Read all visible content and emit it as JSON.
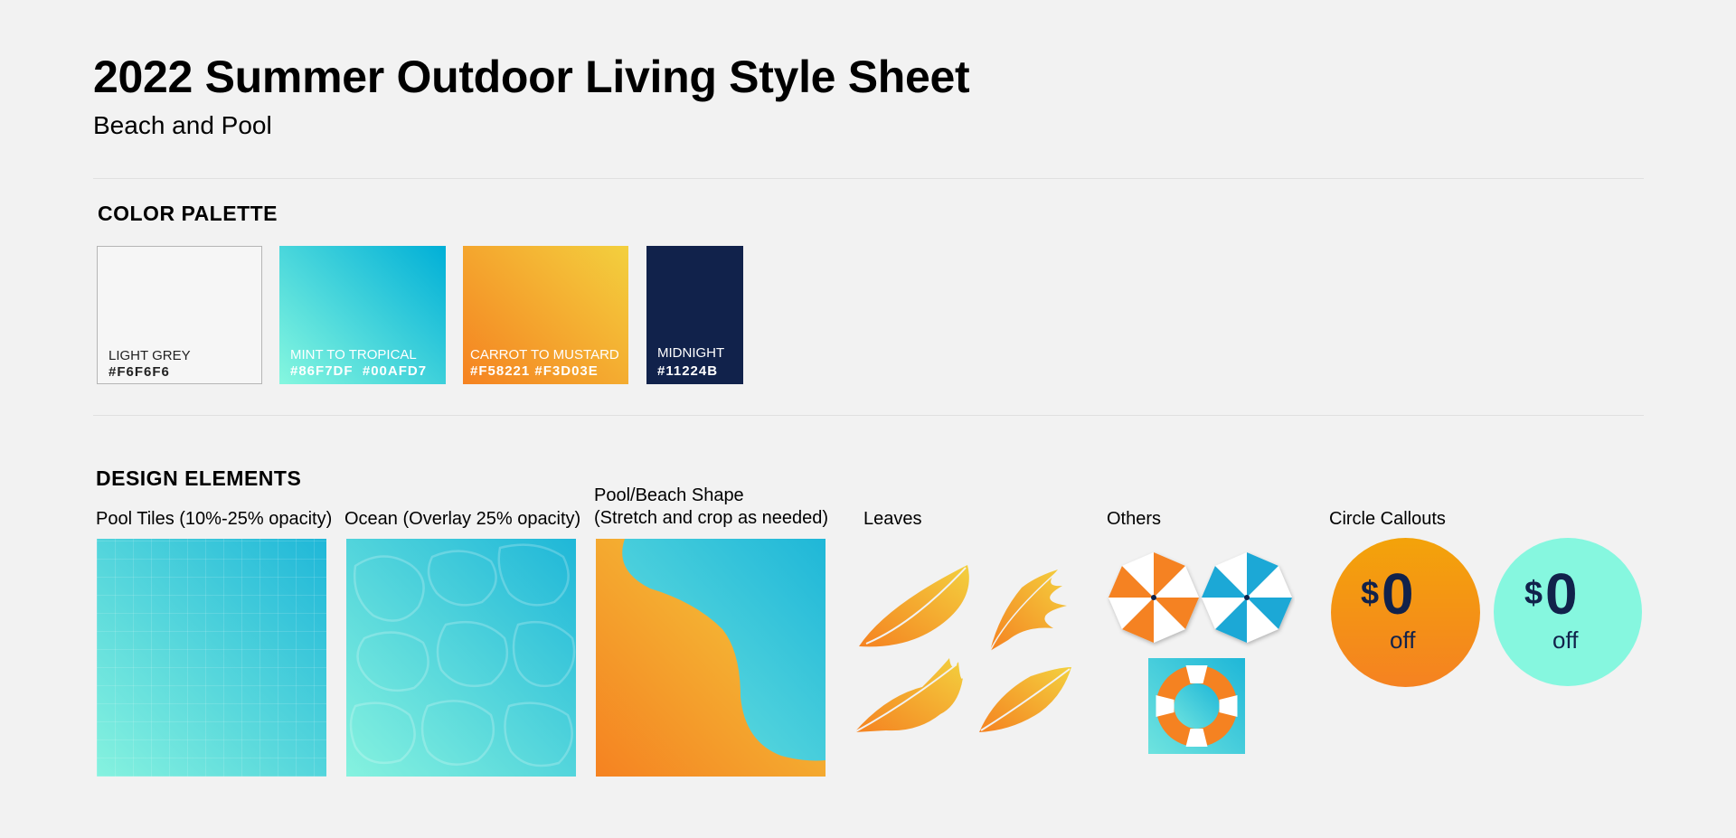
{
  "header": {
    "title": "2022 Summer Outdoor Living Style Sheet",
    "subtitle": "Beach and Pool"
  },
  "palette": {
    "heading": "COLOR PALETTE",
    "swatches": [
      {
        "name": "LIGHT GREY",
        "hex": "#F6F6F6",
        "colors": [
          "#F6F6F6"
        ]
      },
      {
        "name": "MINT TO TROPICAL",
        "hex": "#86F7DF  #00AFD7",
        "colors": [
          "#86F7DF",
          "#00AFD7"
        ]
      },
      {
        "name": "CARROT TO MUSTARD",
        "hex": "#F58221 #F3D03E",
        "colors": [
          "#F58221",
          "#F3D03E"
        ]
      },
      {
        "name": "MIDNIGHT",
        "hex": "#11224B",
        "colors": [
          "#11224B"
        ]
      }
    ]
  },
  "elements": {
    "heading": "DESIGN ELEMENTS",
    "pool_tiles": "Pool Tiles (10%-25% opacity)",
    "ocean": "Ocean (Overlay 25% opacity)",
    "shape_line1": "Pool/Beach Shape",
    "shape_line2": "(Stretch and crop as needed)",
    "leaves": "Leaves",
    "others": "Others",
    "callouts": "Circle Callouts",
    "callout_items": [
      {
        "currency": "$",
        "amount": "0",
        "suffix": "off"
      },
      {
        "currency": "$",
        "amount": "0",
        "suffix": "off"
      }
    ]
  },
  "icons": [
    "leaf-icon",
    "umbrella-icon",
    "life-ring-icon"
  ],
  "colors": {
    "background": "#F2F2F2",
    "midnight": "#11224B",
    "mint": "#86F7DF",
    "tropical": "#00AFD7",
    "carrot": "#F58221",
    "mustard": "#F3D03E"
  }
}
